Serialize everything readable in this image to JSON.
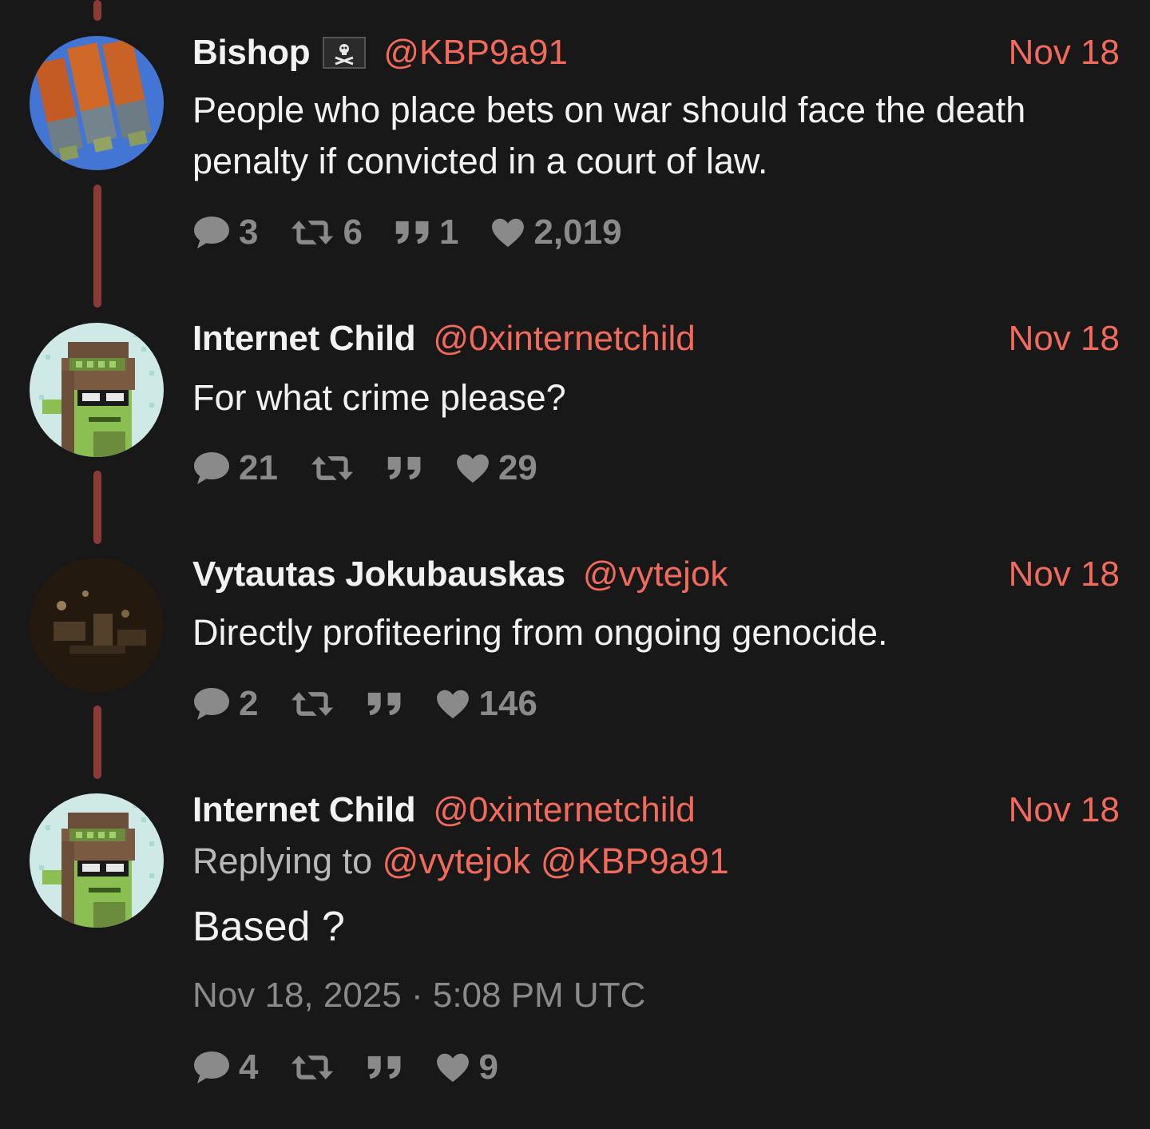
{
  "tweets": [
    {
      "display_name": "Bishop",
      "handle": "@KBP9a91",
      "date": "Nov 18",
      "text": "People who place bets on war should face the death penalty if convicted in a court of law.",
      "stats": {
        "replies": "3",
        "retweets": "6",
        "quotes": "1",
        "likes": "2,019"
      },
      "avatar_icon": "ammo-magazines-avatar",
      "badge_icon": "pirate-flag-icon"
    },
    {
      "display_name": "Internet Child",
      "handle": "@0xinternetchild",
      "date": "Nov 18",
      "text": "For what crime please?",
      "stats": {
        "replies": "21",
        "retweets": "",
        "quotes": "",
        "likes": "29"
      },
      "avatar_icon": "pixel-goblin-avatar"
    },
    {
      "display_name": "Vytautas Jokubauskas",
      "handle": "@vytejok",
      "date": "Nov 18",
      "text": "Directly profiteering from ongoing genocide.",
      "stats": {
        "replies": "2",
        "retweets": "",
        "quotes": "",
        "likes": "146"
      },
      "avatar_icon": "dark-room-avatar"
    },
    {
      "display_name": "Internet Child",
      "handle": "@0xinternetchild",
      "date": "Nov 18",
      "replying_prefix": "Replying to",
      "replying_to": [
        "@vytejok",
        "@KBP9a91"
      ],
      "text": "Based ?",
      "timestamp": "Nov 18, 2025 · 5:08 PM UTC",
      "stats": {
        "replies": "4",
        "retweets": "",
        "quotes": "",
        "likes": "9"
      },
      "avatar_icon": "pixel-goblin-avatar"
    }
  ],
  "colors": {
    "background": "#181818",
    "accent": "#f26a5b",
    "thread_line": "#8b3a36",
    "muted": "#8a8a8a"
  }
}
